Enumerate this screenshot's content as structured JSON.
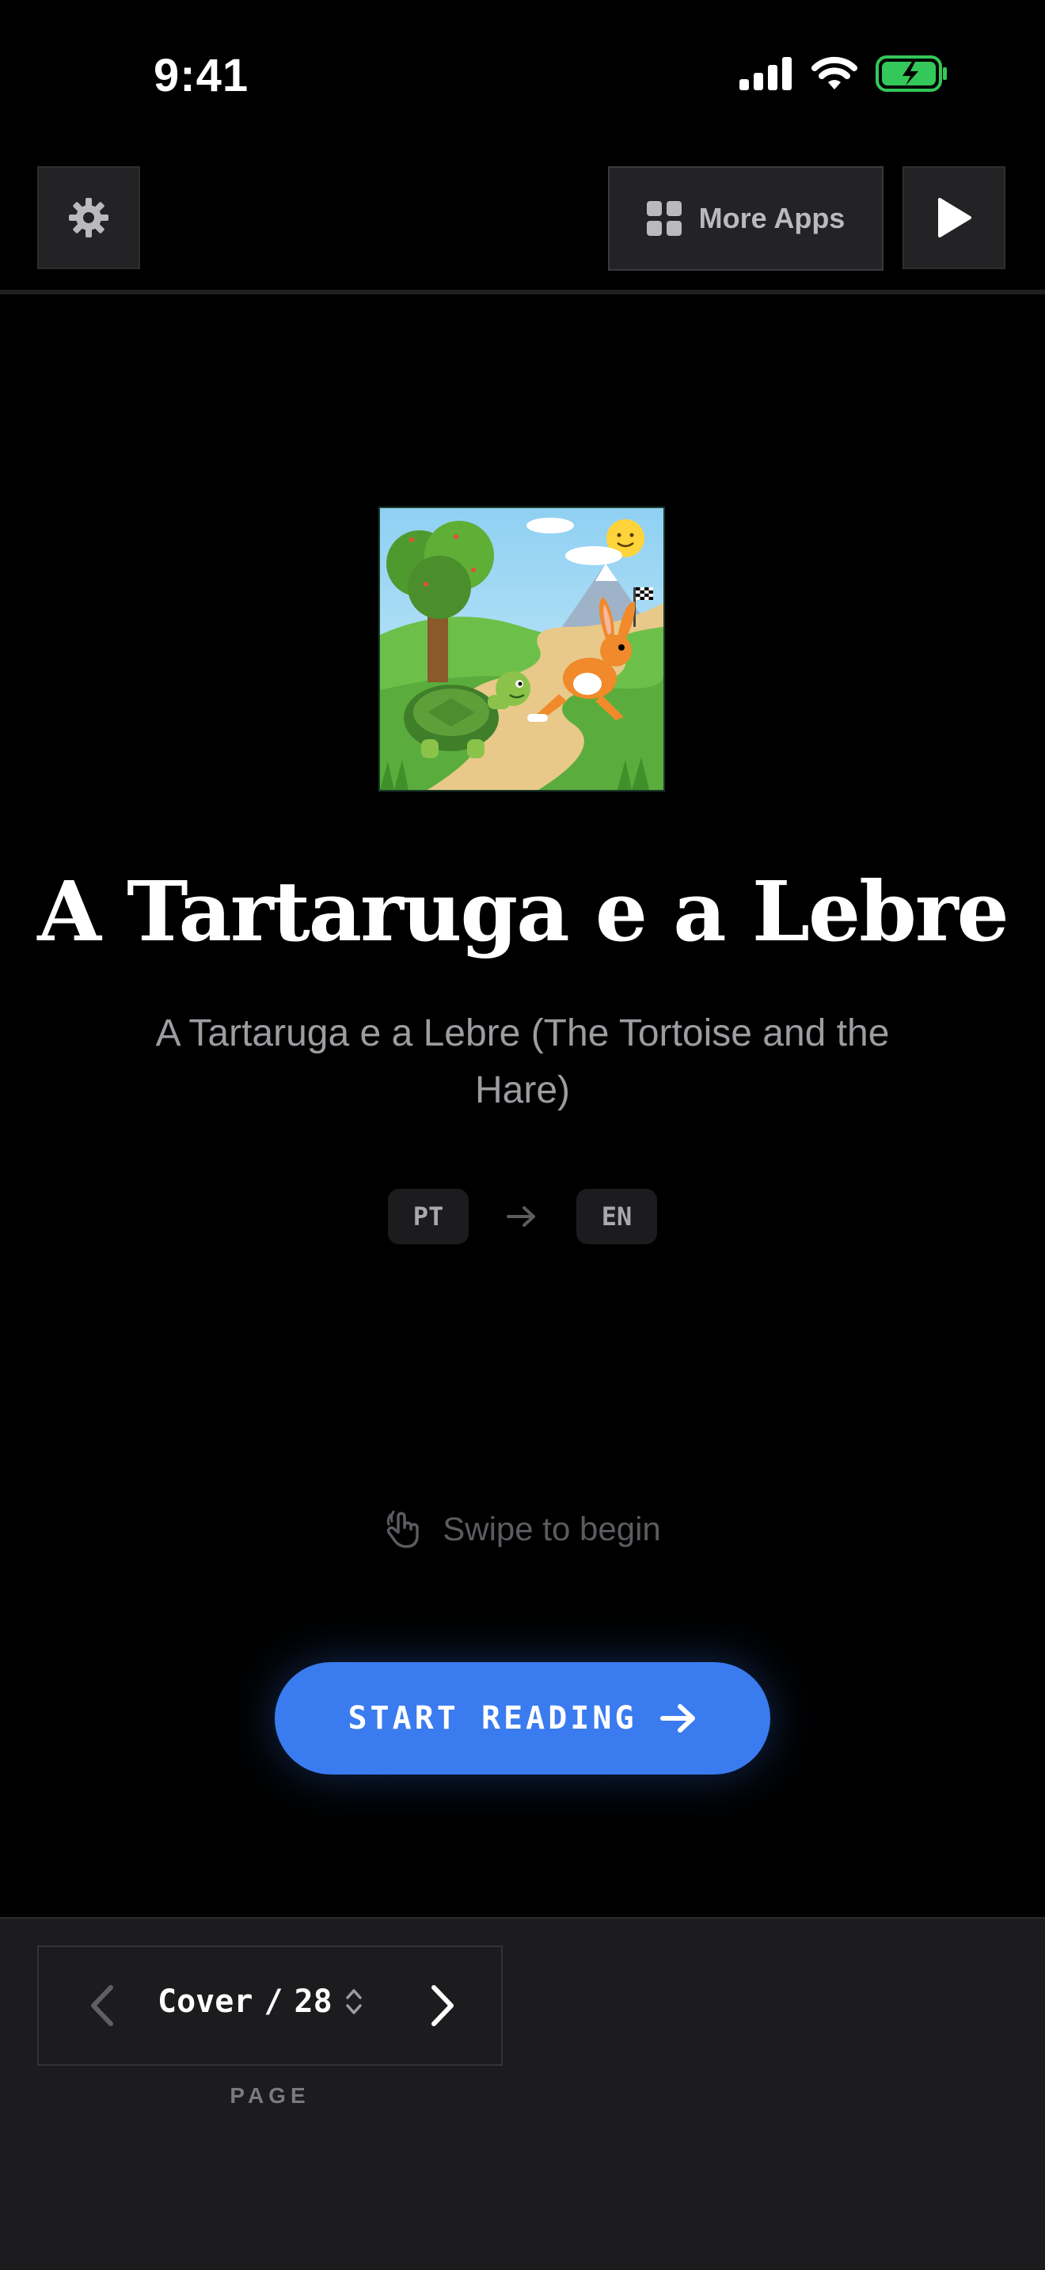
{
  "status_bar": {
    "time": "9:41"
  },
  "top_bar": {
    "more_apps_label": "More Apps"
  },
  "book": {
    "title": "A Tartaruga e a Lebre",
    "subtitle": "A Tartaruga e a Lebre (The Tortoise and the Hare)",
    "source_lang": "PT",
    "target_lang": "EN"
  },
  "swipe_hint": "Swipe to begin",
  "start_button": {
    "label": "START READING"
  },
  "pagination": {
    "current": "Cover",
    "separator": "/",
    "total": "28",
    "caption": "PAGE"
  },
  "colors": {
    "background": "#000000",
    "accent": "#3a7bef",
    "bottom_bar": "#1c1c1e",
    "battery": "#34c759"
  },
  "icons": [
    "gear-icon",
    "grid-icon",
    "play-icon",
    "arrow-right-icon",
    "hand-swipe-icon",
    "chevron-left-icon",
    "chevron-right-icon",
    "sort-updown-icon",
    "signal-icon",
    "wifi-icon",
    "battery-icon"
  ]
}
